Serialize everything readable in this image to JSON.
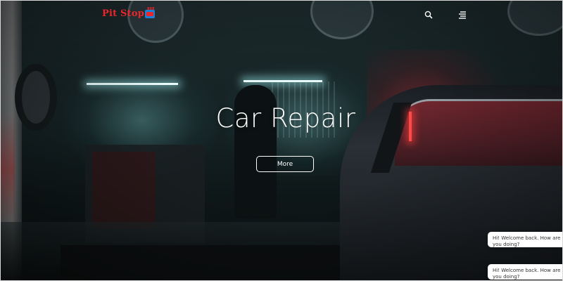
{
  "header": {
    "logo": {
      "text_part1": "Pit Stop",
      "badge_text": "888"
    },
    "search_icon": "search-icon",
    "menu_icon": "hamburger-menu-icon"
  },
  "hero": {
    "title": "Car Repair",
    "button_label": "More"
  },
  "chat": {
    "bubbles": [
      {
        "text": "Hi! Welcome back. How are you doing?"
      },
      {
        "text": "Hi! Welcome back. How are you doing?"
      }
    ]
  },
  "colors": {
    "logo_red": "#e8262b",
    "logo_blue": "#1c7fd6",
    "button_border": "#ffffff",
    "accent_red_light": "#ff4a4a"
  }
}
